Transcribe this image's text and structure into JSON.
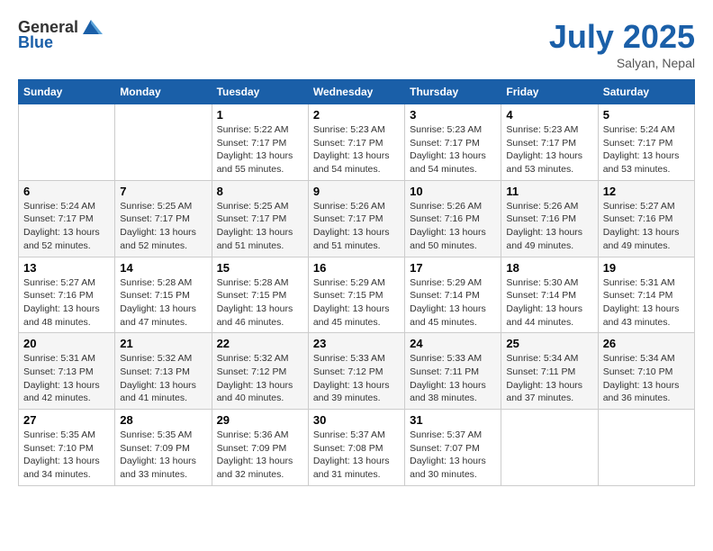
{
  "header": {
    "logo_general": "General",
    "logo_blue": "Blue",
    "month": "July 2025",
    "location": "Salyan, Nepal"
  },
  "days_of_week": [
    "Sunday",
    "Monday",
    "Tuesday",
    "Wednesday",
    "Thursday",
    "Friday",
    "Saturday"
  ],
  "weeks": [
    [
      {
        "day": "",
        "info": ""
      },
      {
        "day": "",
        "info": ""
      },
      {
        "day": "1",
        "info": "Sunrise: 5:22 AM\nSunset: 7:17 PM\nDaylight: 13 hours and 55 minutes."
      },
      {
        "day": "2",
        "info": "Sunrise: 5:23 AM\nSunset: 7:17 PM\nDaylight: 13 hours and 54 minutes."
      },
      {
        "day": "3",
        "info": "Sunrise: 5:23 AM\nSunset: 7:17 PM\nDaylight: 13 hours and 54 minutes."
      },
      {
        "day": "4",
        "info": "Sunrise: 5:23 AM\nSunset: 7:17 PM\nDaylight: 13 hours and 53 minutes."
      },
      {
        "day": "5",
        "info": "Sunrise: 5:24 AM\nSunset: 7:17 PM\nDaylight: 13 hours and 53 minutes."
      }
    ],
    [
      {
        "day": "6",
        "info": "Sunrise: 5:24 AM\nSunset: 7:17 PM\nDaylight: 13 hours and 52 minutes."
      },
      {
        "day": "7",
        "info": "Sunrise: 5:25 AM\nSunset: 7:17 PM\nDaylight: 13 hours and 52 minutes."
      },
      {
        "day": "8",
        "info": "Sunrise: 5:25 AM\nSunset: 7:17 PM\nDaylight: 13 hours and 51 minutes."
      },
      {
        "day": "9",
        "info": "Sunrise: 5:26 AM\nSunset: 7:17 PM\nDaylight: 13 hours and 51 minutes."
      },
      {
        "day": "10",
        "info": "Sunrise: 5:26 AM\nSunset: 7:16 PM\nDaylight: 13 hours and 50 minutes."
      },
      {
        "day": "11",
        "info": "Sunrise: 5:26 AM\nSunset: 7:16 PM\nDaylight: 13 hours and 49 minutes."
      },
      {
        "day": "12",
        "info": "Sunrise: 5:27 AM\nSunset: 7:16 PM\nDaylight: 13 hours and 49 minutes."
      }
    ],
    [
      {
        "day": "13",
        "info": "Sunrise: 5:27 AM\nSunset: 7:16 PM\nDaylight: 13 hours and 48 minutes."
      },
      {
        "day": "14",
        "info": "Sunrise: 5:28 AM\nSunset: 7:15 PM\nDaylight: 13 hours and 47 minutes."
      },
      {
        "day": "15",
        "info": "Sunrise: 5:28 AM\nSunset: 7:15 PM\nDaylight: 13 hours and 46 minutes."
      },
      {
        "day": "16",
        "info": "Sunrise: 5:29 AM\nSunset: 7:15 PM\nDaylight: 13 hours and 45 minutes."
      },
      {
        "day": "17",
        "info": "Sunrise: 5:29 AM\nSunset: 7:14 PM\nDaylight: 13 hours and 45 minutes."
      },
      {
        "day": "18",
        "info": "Sunrise: 5:30 AM\nSunset: 7:14 PM\nDaylight: 13 hours and 44 minutes."
      },
      {
        "day": "19",
        "info": "Sunrise: 5:31 AM\nSunset: 7:14 PM\nDaylight: 13 hours and 43 minutes."
      }
    ],
    [
      {
        "day": "20",
        "info": "Sunrise: 5:31 AM\nSunset: 7:13 PM\nDaylight: 13 hours and 42 minutes."
      },
      {
        "day": "21",
        "info": "Sunrise: 5:32 AM\nSunset: 7:13 PM\nDaylight: 13 hours and 41 minutes."
      },
      {
        "day": "22",
        "info": "Sunrise: 5:32 AM\nSunset: 7:12 PM\nDaylight: 13 hours and 40 minutes."
      },
      {
        "day": "23",
        "info": "Sunrise: 5:33 AM\nSunset: 7:12 PM\nDaylight: 13 hours and 39 minutes."
      },
      {
        "day": "24",
        "info": "Sunrise: 5:33 AM\nSunset: 7:11 PM\nDaylight: 13 hours and 38 minutes."
      },
      {
        "day": "25",
        "info": "Sunrise: 5:34 AM\nSunset: 7:11 PM\nDaylight: 13 hours and 37 minutes."
      },
      {
        "day": "26",
        "info": "Sunrise: 5:34 AM\nSunset: 7:10 PM\nDaylight: 13 hours and 36 minutes."
      }
    ],
    [
      {
        "day": "27",
        "info": "Sunrise: 5:35 AM\nSunset: 7:10 PM\nDaylight: 13 hours and 34 minutes."
      },
      {
        "day": "28",
        "info": "Sunrise: 5:35 AM\nSunset: 7:09 PM\nDaylight: 13 hours and 33 minutes."
      },
      {
        "day": "29",
        "info": "Sunrise: 5:36 AM\nSunset: 7:09 PM\nDaylight: 13 hours and 32 minutes."
      },
      {
        "day": "30",
        "info": "Sunrise: 5:37 AM\nSunset: 7:08 PM\nDaylight: 13 hours and 31 minutes."
      },
      {
        "day": "31",
        "info": "Sunrise: 5:37 AM\nSunset: 7:07 PM\nDaylight: 13 hours and 30 minutes."
      },
      {
        "day": "",
        "info": ""
      },
      {
        "day": "",
        "info": ""
      }
    ]
  ]
}
